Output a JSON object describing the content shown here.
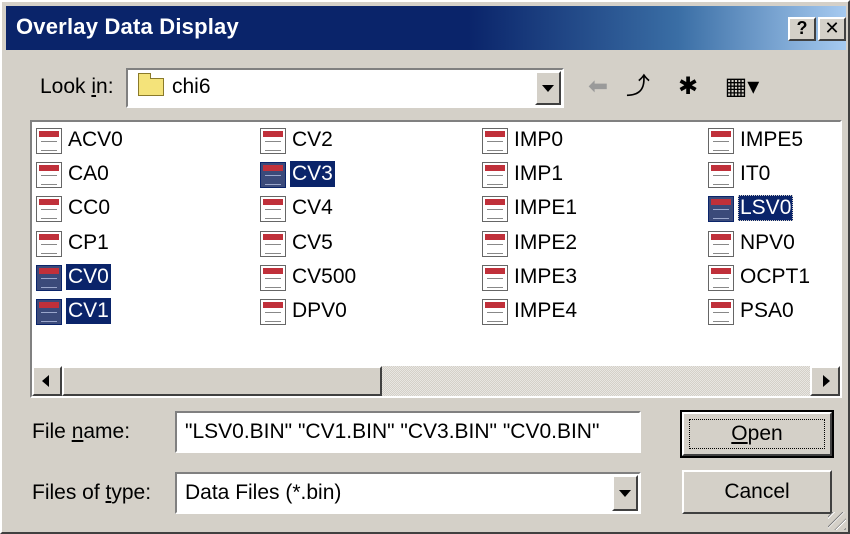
{
  "window": {
    "title": "Overlay Data Display",
    "help_label": "?",
    "close_label": "✕"
  },
  "lookin": {
    "label_pre": "Look ",
    "label_accel": "i",
    "label_post": "n:",
    "value": "chi6"
  },
  "toolbar": {
    "back_icon": "back-arrow-icon",
    "up_icon": "up-one-level-icon",
    "new_folder_icon": "new-folder-icon",
    "view_icon": "view-menu-icon",
    "back_glyph": "⬅",
    "up_glyph": "⤴",
    "new_glyph": "✱",
    "view_glyph": "▦▾"
  },
  "files": {
    "columns": [
      [
        {
          "name": "ACV0",
          "selected": false
        },
        {
          "name": "CA0",
          "selected": false
        },
        {
          "name": "CC0",
          "selected": false
        },
        {
          "name": "CP1",
          "selected": false
        },
        {
          "name": "CV0",
          "selected": true
        },
        {
          "name": "CV1",
          "selected": true
        }
      ],
      [
        {
          "name": "CV2",
          "selected": false
        },
        {
          "name": "CV3",
          "selected": true
        },
        {
          "name": "CV4",
          "selected": false
        },
        {
          "name": "CV5",
          "selected": false
        },
        {
          "name": "CV500",
          "selected": false
        },
        {
          "name": "DPV0",
          "selected": false
        }
      ],
      [
        {
          "name": "IMP0",
          "selected": false
        },
        {
          "name": "IMP1",
          "selected": false
        },
        {
          "name": "IMPE1",
          "selected": false
        },
        {
          "name": "IMPE2",
          "selected": false
        },
        {
          "name": "IMPE3",
          "selected": false
        },
        {
          "name": "IMPE4",
          "selected": false
        }
      ],
      [
        {
          "name": "IMPE5",
          "selected": false
        },
        {
          "name": "IT0",
          "selected": false
        },
        {
          "name": "LSV0",
          "selected": true,
          "focus": true
        },
        {
          "name": "NPV0",
          "selected": false
        },
        {
          "name": "OCPT1",
          "selected": false
        },
        {
          "name": "PSA0",
          "selected": false
        }
      ]
    ],
    "file_icon": "document-file-icon"
  },
  "filename": {
    "label_pre": "File ",
    "label_accel": "n",
    "label_post": "ame:",
    "value": "\"LSV0.BIN\" \"CV1.BIN\" \"CV3.BIN\" \"CV0.BIN\""
  },
  "filetype": {
    "label_pre": "Files of ",
    "label_accel": "t",
    "label_post": "ype:",
    "value": "Data Files (*.bin)"
  },
  "buttons": {
    "open_accel": "O",
    "open_rest": "pen",
    "cancel": "Cancel"
  }
}
